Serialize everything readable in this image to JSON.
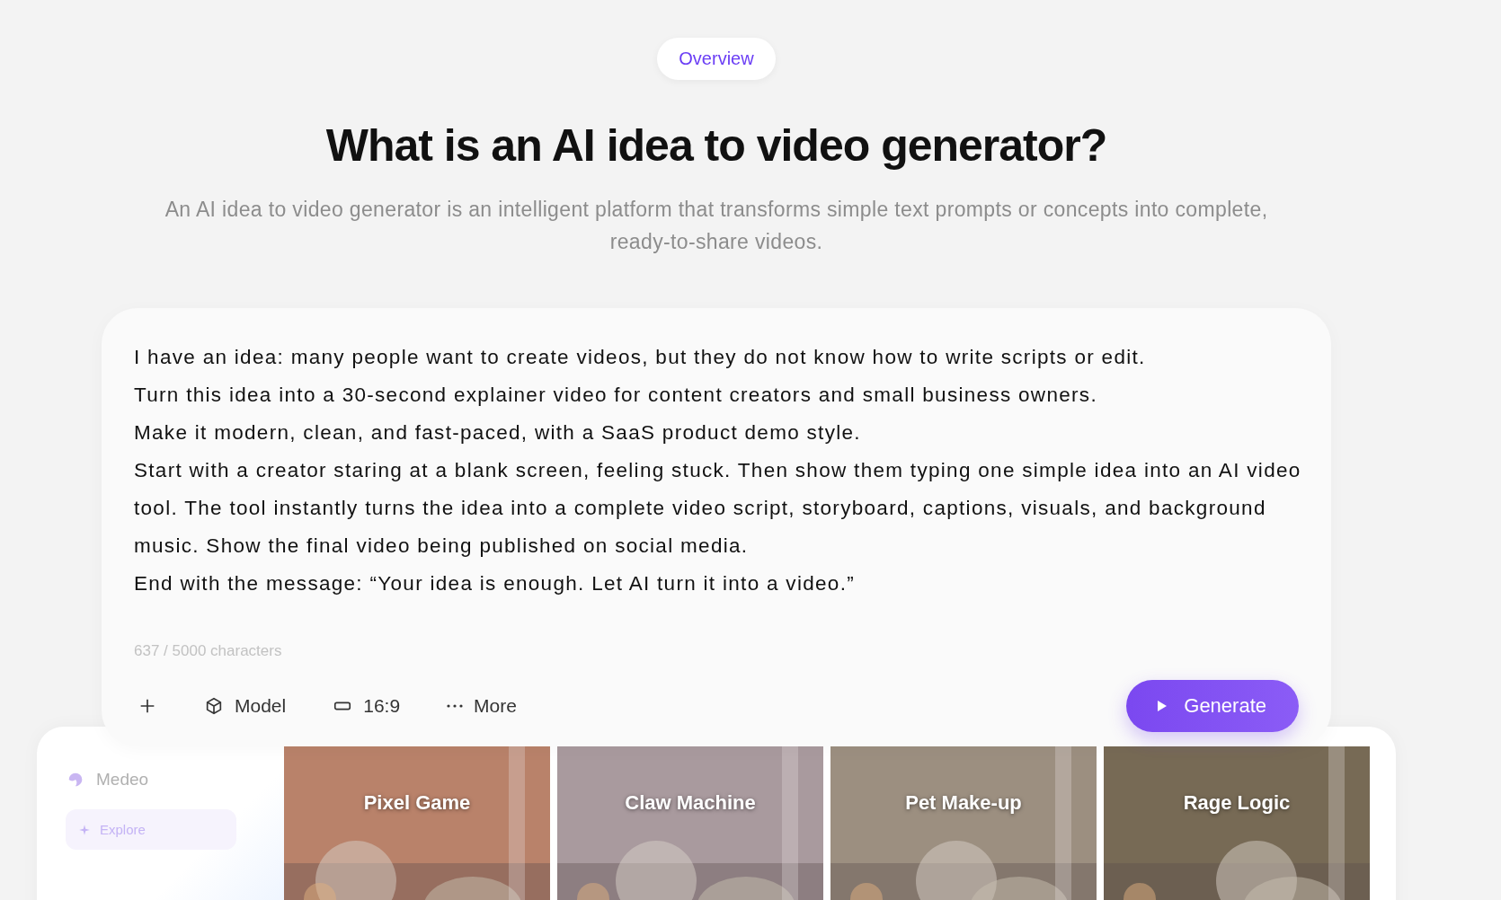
{
  "badge": {
    "label": "Overview"
  },
  "heading": "What is an AI idea to video generator?",
  "subtitle": "An AI idea to video generator is an intelligent platform that transforms simple text prompts or concepts into complete, ready-to-share videos.",
  "prompt": {
    "value": [
      "I have an idea: many people want to create videos, but they do not know how to write scripts or edit.",
      "Turn this idea into a 30-second explainer video for content creators and small business owners.",
      "Make it modern, clean, and fast-paced, with a SaaS product demo style.",
      "Start with a creator staring at a blank screen, feeling stuck. Then show them typing one simple idea into an AI video tool. The tool instantly turns the idea into a complete video script, storyboard, captions, visuals, and background music. Show the final video being published on social media.",
      "End with the message: “Your idea is enough. Let AI turn it into a video.”"
    ],
    "counter": "637 / 5000 characters"
  },
  "toolbar": [
    {
      "kind": "add"
    },
    {
      "kind": "model",
      "label": "Model"
    },
    {
      "kind": "ratio",
      "label": "16:9"
    },
    {
      "kind": "more",
      "label": "More"
    }
  ],
  "generate": {
    "label": "Generate"
  },
  "preview": {
    "brand": "Medeo",
    "nav": [
      {
        "label": "Explore",
        "selected": true
      }
    ],
    "tiles": [
      {
        "title": "Pixel Game"
      },
      {
        "title": "Claw Machine"
      },
      {
        "title": "Pet Make-up"
      },
      {
        "title": "Rage Logic"
      }
    ]
  }
}
